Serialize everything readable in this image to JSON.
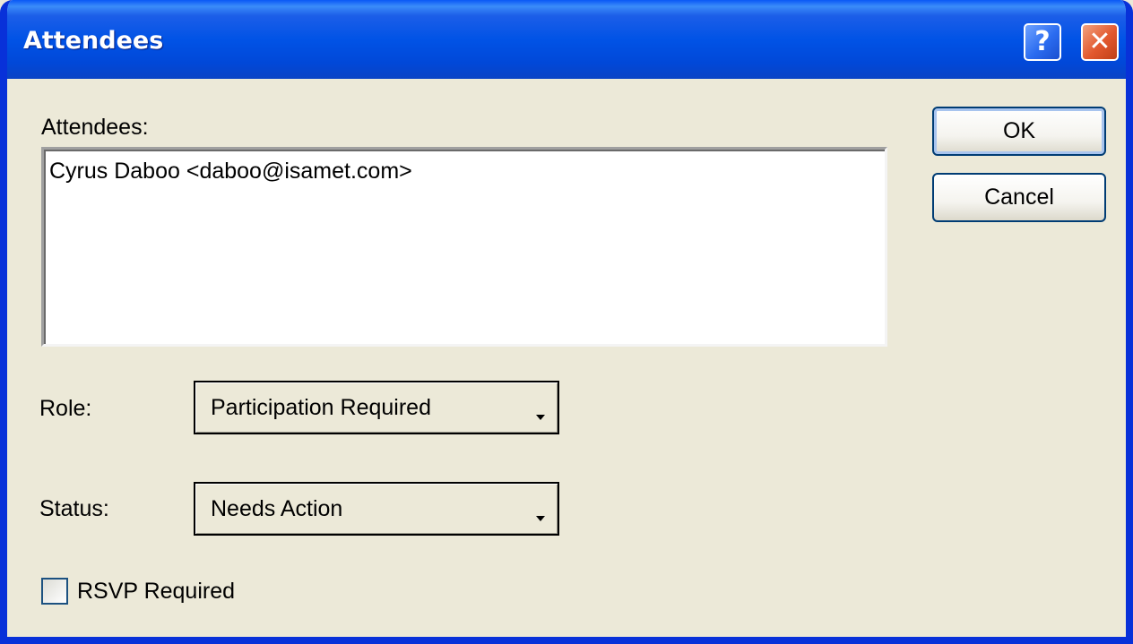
{
  "window": {
    "title": "Attendees",
    "help_glyph": "?",
    "close_glyph": "✕"
  },
  "attendees": {
    "label": "Attendees:",
    "items": [
      "Cyrus Daboo <daboo@isamet.com>"
    ]
  },
  "role": {
    "label": "Role:",
    "value": "Participation Required"
  },
  "status": {
    "label": "Status:",
    "value": "Needs Action"
  },
  "rsvp": {
    "label": "RSVP Required",
    "checked": false
  },
  "buttons": {
    "ok": "OK",
    "cancel": "Cancel"
  },
  "icons": [
    "help-icon",
    "close-icon",
    "dropdown-arrow-icon",
    "checkbox-icon"
  ]
}
